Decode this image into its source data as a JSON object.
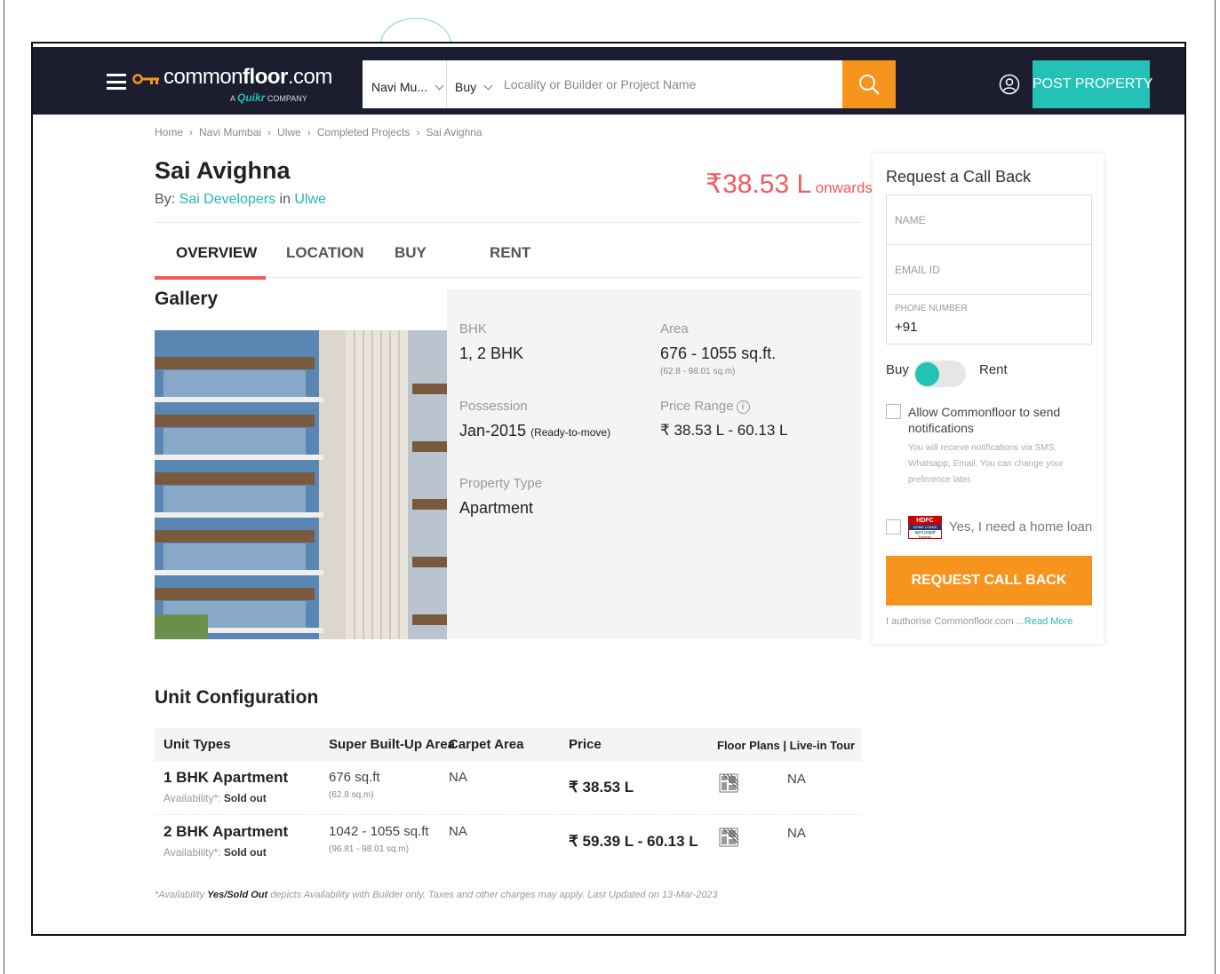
{
  "header": {
    "logo_text_regular": "common",
    "logo_text_bold": "floor",
    "logo_text_suffix": ".com",
    "logo_sub_a": "A ",
    "logo_sub_brand": "Quikr",
    "logo_sub_company": " COMPANY",
    "city_select": "Navi Mu...",
    "type_select": "Buy",
    "search_placeholder": "Locality or Builder or Project Name",
    "post_property": "POST PROPERTY"
  },
  "breadcrumb": [
    "Home",
    "Navi Mumbai",
    "Ulwe",
    "Completed Projects",
    "Sai Avighna"
  ],
  "project": {
    "title": "Sai Avighna",
    "by_label": "By: ",
    "developer": "Sai Developers",
    "in_label": " in ",
    "locality": "Ulwe",
    "price": "₹38.53 L",
    "price_suffix": "onwards"
  },
  "tabs": [
    "OVERVIEW",
    "LOCATION",
    "BUY",
    "RENT"
  ],
  "gallery": {
    "title": "Gallery"
  },
  "facts": {
    "bhk_label": "BHK",
    "bhk_value": "1, 2 BHK",
    "area_label": "Area",
    "area_value": "676 - 1055 sq.ft.",
    "area_sub": "(62.8 - 98.01 sq.m)",
    "possession_label": "Possession",
    "possession_value": "Jan-2015",
    "possession_note": "(Ready-to-move)",
    "price_range_label": "Price Range",
    "price_range_value": "₹ 38.53 L - 60.13 L",
    "property_type_label": "Property Type",
    "property_type_value": "Apartment"
  },
  "form": {
    "title": "Request a Call Back",
    "name_placeholder": "NAME",
    "email_placeholder": "EMAIL ID",
    "phone_label": "PHONE NUMBER",
    "phone_prefix": "+91",
    "toggle_left": "Buy",
    "toggle_right": "Rent",
    "notify_text": "Allow Commonfloor to send notifications",
    "notify_sub": "You will recieve notifications via SMS, Whatsapp, Email. You can change your preference later.",
    "loan_text": "Yes, I need a home loan",
    "hdfc_top": "HDFC",
    "hdfc_mid": "HOME LOANS",
    "hdfc_bot": "apni pagdi hamar",
    "button": "REQUEST CALL BACK",
    "auth_text": "I authorise Commonfloor.com ...",
    "read_more": "Read More"
  },
  "unit_config": {
    "title": "Unit Configuration",
    "headers": [
      "Unit Types",
      "Super Built-Up Area",
      "Carpet Area",
      "Price",
      "Floor Plans | Live-in Tour"
    ],
    "rows": [
      {
        "type": "1 BHK Apartment",
        "availability_label": "Availability*: ",
        "availability": "Sold out",
        "area": "676 sq.ft",
        "area_sub": "(62.8 sq.m)",
        "carpet": "NA",
        "price": "₹ 38.53 L",
        "tour": "NA"
      },
      {
        "type": "2 BHK Apartment",
        "availability_label": "Availability*: ",
        "availability": "Sold out",
        "area": "1042 - 1055 sq.ft",
        "area_sub": "(96.81 - 98.01 sq.m)",
        "carpet": "NA",
        "price": "₹ 59.39 L - 60.13 L",
        "tour": "NA"
      }
    ],
    "footnote_a": "*Availability ",
    "footnote_b": "Yes/Sold Out",
    "footnote_c": " depicts Availability with Builder only. Taxes and other charges may apply. Last Updated on 13-Mar-2023"
  },
  "colors": {
    "header_bg": "#1c1d2e",
    "accent_teal": "#23c1b6",
    "accent_orange": "#f7941d",
    "price_red": "#f35a5a"
  }
}
